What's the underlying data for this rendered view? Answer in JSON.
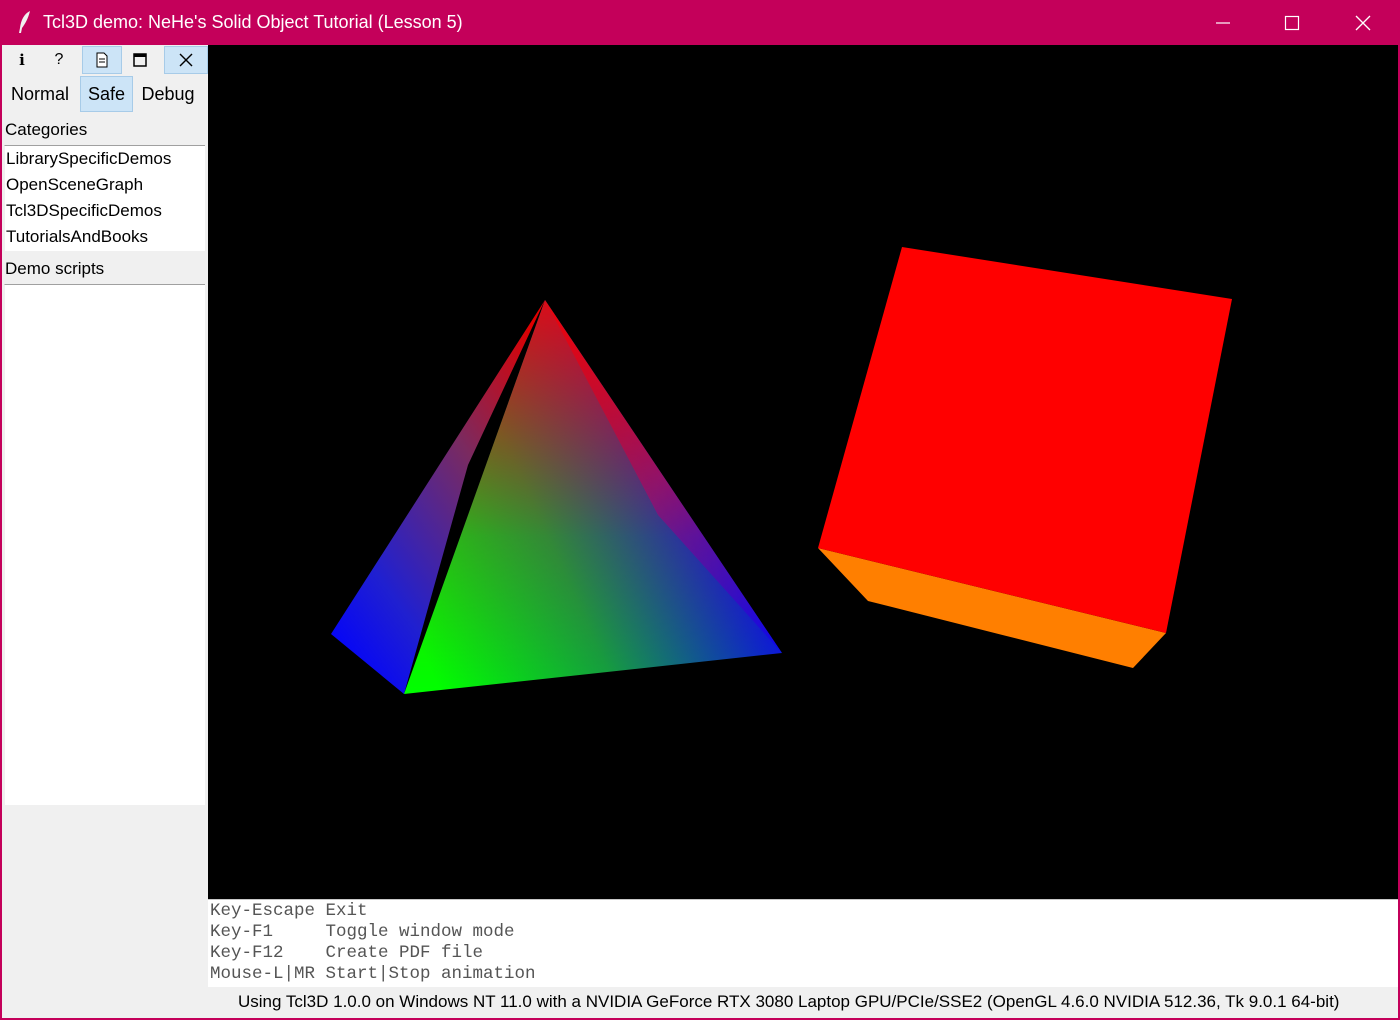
{
  "window": {
    "title": "Tcl3D demo: NeHe's Solid Object Tutorial (Lesson 5)",
    "title_bar_color": "#c4005a"
  },
  "toolbar": {
    "buttons": [
      {
        "icon": "info-icon",
        "glyph": "i"
      },
      {
        "icon": "help-icon",
        "glyph": "?"
      },
      {
        "icon": "document-icon",
        "glyph": ""
      },
      {
        "icon": "maximize-icon",
        "glyph": ""
      },
      {
        "icon": "close-icon",
        "glyph": ""
      }
    ]
  },
  "modes": {
    "normal": "Normal",
    "safe": "Safe",
    "debug": "Debug",
    "selected": "Safe"
  },
  "categories": {
    "label": "Categories",
    "items": [
      "LibrarySpecificDemos",
      "OpenSceneGraph",
      "Tcl3DSpecificDemos",
      "TutorialsAndBooks"
    ]
  },
  "demo_scripts": {
    "label": "Demo scripts",
    "items": []
  },
  "help": {
    "lines": [
      "Key-Escape Exit",
      "Key-F1     Toggle window mode",
      "Key-F12    Create PDF file",
      "Mouse-L|MR Start|Stop animation"
    ]
  },
  "status": {
    "text": "Using Tcl3D 1.0.0 on Windows NT 11.0 with a NVIDIA GeForce RTX 3080 Laptop GPU/PCIe/SSE2 (OpenGL 4.6.0 NVIDIA 512.36, Tk 9.0.1 64-bit)"
  },
  "scene": {
    "background": "#000000",
    "pyramid_colors": {
      "top": "#ff0000",
      "left": "#0000ff",
      "front": "#00ff00",
      "right": "#0000ff"
    },
    "cube_colors": {
      "front": "#ff0000",
      "bottom": "#ff7f00"
    }
  }
}
